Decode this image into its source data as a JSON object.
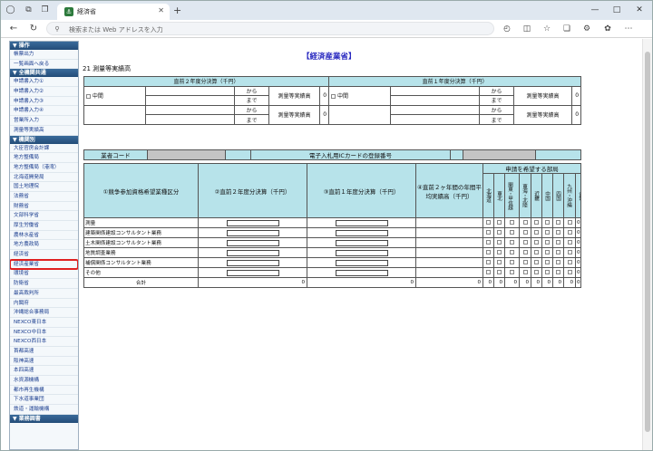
{
  "browser": {
    "tab_title": "経済省",
    "address_placeholder": "検索または Web アドレスを入力"
  },
  "sidebar": {
    "sections": [
      {
        "label": "▼ 操作",
        "items": [
          "帳票出力",
          "一覧画面へ戻る"
        ]
      },
      {
        "label": "▼ 全機関共通",
        "items": [
          "申請書入力①",
          "申請書入力②",
          "申請書入力③",
          "申請書入力④",
          "営業所入力",
          "測量等実績高"
        ]
      },
      {
        "label": "▼ 機関別",
        "items": [
          "大臣官房会計課",
          "地方整備局",
          "地方整備局（港湾）",
          "北海道開発局",
          "国土地理院",
          "法務省",
          "財務省",
          "文部科学省",
          "厚生労働省",
          "農林水産省",
          "地方農政局",
          "経済省",
          "経済産業省",
          "環境省",
          "防衛省",
          "最高裁判所",
          "内閣府",
          "沖縄総合事務局",
          "NEXCO東日本",
          "NEXCO中日本",
          "NEXCO西日本",
          "首都高速",
          "阪神高速",
          "本四高速",
          "水資源機構",
          "都市再生機構",
          "下水道事業団",
          "鉄道・運輸機構"
        ]
      },
      {
        "label": "▼ 業務調書",
        "items": []
      }
    ],
    "highlighted_item": "経済産業省"
  },
  "content": {
    "page_title": "【経済産業省】",
    "section_title": "21 測量等実績高",
    "prev2_header": "直前２年度分決算（千円）",
    "prev1_header": "直前１年度分決算（千円）",
    "chukan_label": "中間",
    "from_label": "から",
    "to_label": "まで",
    "jisseki_label": "測量等実績高",
    "zero": "0",
    "gyosha_code_label": "業者コード",
    "ic_card_label": "電子入札用ICカードの登録番号",
    "col1": "①競争参加資格希望業種区分",
    "col2": "②直前２年度分決算（千円）",
    "col3": "③直前１年度分決算（千円）",
    "col4": "④直前２ヶ年間の年間平均実績高（千円）",
    "regions_header": "申請を希望する部局",
    "regions": [
      "北海道",
      "東北",
      "関東・甲信越",
      "東海・北陸",
      "近畿",
      "中国",
      "四国",
      "九州・沖縄"
    ],
    "total_label": "合計",
    "rows": [
      "測量",
      "建築関係建設コンサルタント業務",
      "土木関係建設コンサルタント業務",
      "地質調査業務",
      "補償関係コンサルタント業務",
      "その他"
    ],
    "sum_label": "合計",
    "sum_values": [
      "0",
      "0",
      "0",
      "0"
    ]
  }
}
